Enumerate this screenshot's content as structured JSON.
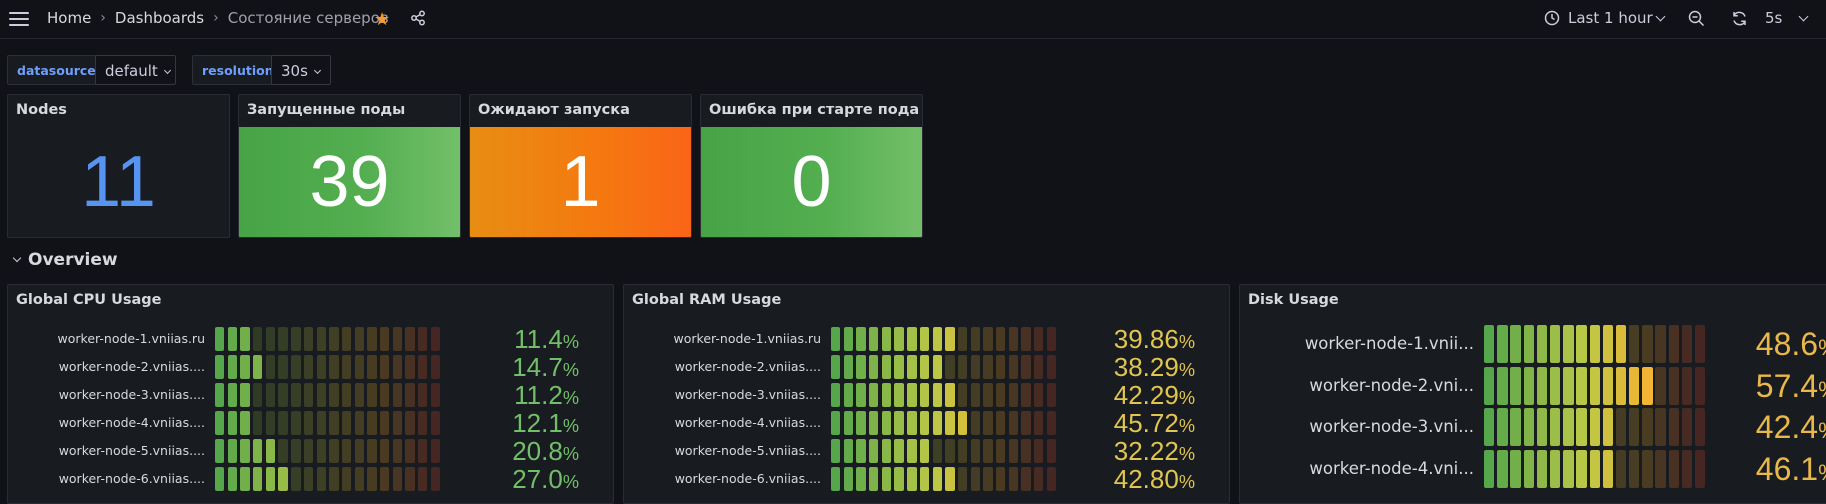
{
  "topbar": {
    "breadcrumbs": [
      "Home",
      "Dashboards",
      "Состояние серверов"
    ],
    "time_range": "Last 1 hour",
    "refresh_interval": "5s"
  },
  "variables": [
    {
      "name": "datasource",
      "value": "default"
    },
    {
      "name": "resolution",
      "value": "30s"
    }
  ],
  "stats": [
    {
      "title": "Nodes",
      "value": "11",
      "color": "#5794f2",
      "style": "text"
    },
    {
      "title": "Запущенные поды",
      "value": "39",
      "color": "#56a64b",
      "style": "green"
    },
    {
      "title": "Ожидают запуска",
      "value": "1",
      "color": "#fa6400",
      "style": "orange"
    },
    {
      "title": "Ошибка при старте пода",
      "value": "0",
      "color": "#56a64b",
      "style": "green"
    }
  ],
  "row": {
    "title": "Overview"
  },
  "gauges": [
    {
      "title": "Global CPU Usage",
      "unit": "%",
      "value_color": "#73bf69",
      "rows": [
        {
          "name": "worker-node-1.vniias.ru",
          "value": "11.4",
          "percent": 11.4
        },
        {
          "name": "worker-node-2.vniias....",
          "value": "14.7",
          "percent": 14.7
        },
        {
          "name": "worker-node-3.vniias....",
          "value": "11.2",
          "percent": 11.2
        },
        {
          "name": "worker-node-4.vniias....",
          "value": "12.1",
          "percent": 12.1
        },
        {
          "name": "worker-node-5.vniias....",
          "value": "20.8",
          "percent": 20.8
        },
        {
          "name": "worker-node-6.vniias....",
          "value": "27.0",
          "percent": 27.0
        }
      ]
    },
    {
      "title": "Global RAM Usage",
      "unit": "%",
      "value_color": "#e0c550",
      "rows": [
        {
          "name": "worker-node-1.vniias.ru",
          "value": "39.86",
          "percent": 39.86
        },
        {
          "name": "worker-node-2.vniias....",
          "value": "38.29",
          "percent": 38.29
        },
        {
          "name": "worker-node-3.vniias....",
          "value": "42.29",
          "percent": 42.29
        },
        {
          "name": "worker-node-4.vniias....",
          "value": "45.72",
          "percent": 45.72
        },
        {
          "name": "worker-node-5.vniias....",
          "value": "32.22",
          "percent": 32.22
        },
        {
          "name": "worker-node-6.vniias....",
          "value": "42.80",
          "percent": 42.8
        }
      ]
    },
    {
      "title": "Disk Usage",
      "unit": "%",
      "value_color": "#e8b84a",
      "rows": [
        {
          "name": "worker-node-1.vnii...",
          "value": "48.6",
          "percent": 48.6
        },
        {
          "name": "worker-node-2.vni...",
          "value": "57.4",
          "percent": 57.4
        },
        {
          "name": "worker-node-3.vni...",
          "value": "42.4",
          "percent": 42.4
        },
        {
          "name": "worker-node-4.vni...",
          "value": "46.1",
          "percent": 46.1
        }
      ]
    }
  ],
  "icons": [
    "menu-icon",
    "star-icon",
    "share-icon",
    "clock-icon",
    "zoom-out-icon",
    "refresh-icon"
  ]
}
